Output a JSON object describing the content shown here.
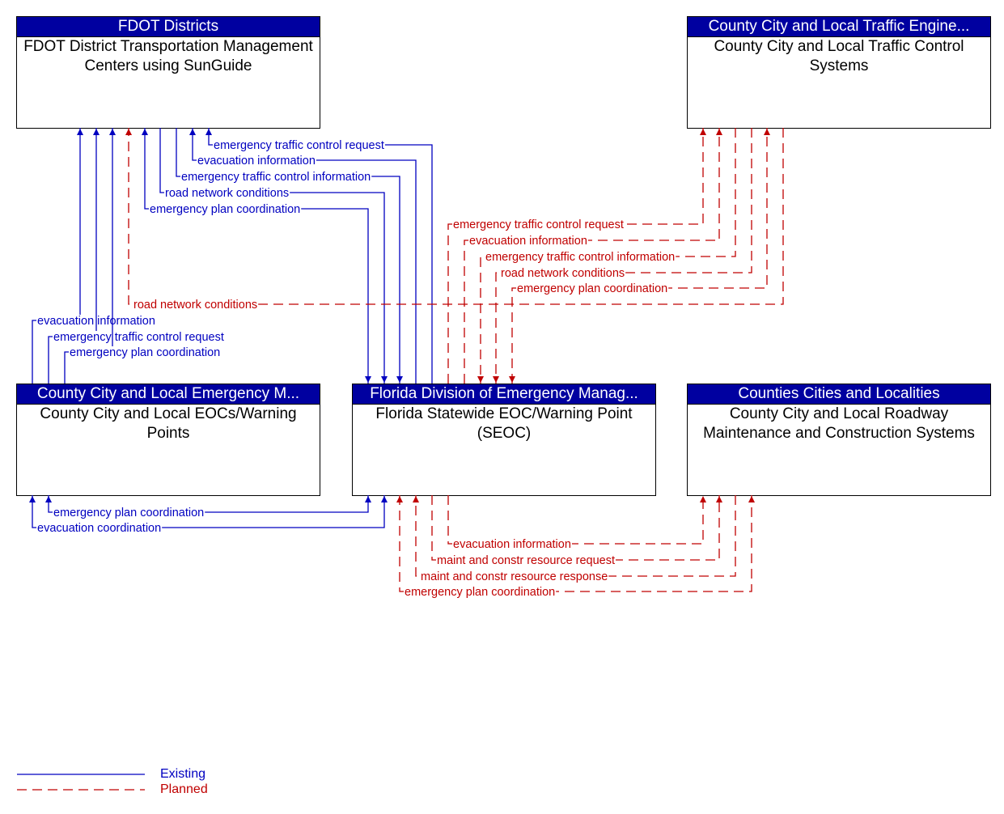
{
  "colors": {
    "existing": "#0000c0",
    "planned": "#c00000",
    "header_bg": "#0000a0"
  },
  "nodes": {
    "fdot": {
      "header": "FDOT Districts",
      "body": "FDOT District Transportation Management Centers using SunGuide"
    },
    "traffic": {
      "header": "County City and Local Traffic Engine...",
      "body": "County City and Local Traffic Control Systems"
    },
    "county_eoc": {
      "header": "County City and Local Emergency M...",
      "body": "County City and Local EOCs/Warning Points"
    },
    "seoc": {
      "header": "Florida Division of Emergency Manag...",
      "body": "Florida Statewide EOC/Warning Point (SEOC)"
    },
    "roadway": {
      "header": "Counties Cities and Localities",
      "body": "County City and Local Roadway Maintenance and Construction Systems"
    }
  },
  "flows": [
    {
      "id": "f1",
      "label": "emergency traffic control request",
      "from": "seoc",
      "to": "fdot",
      "status": "existing"
    },
    {
      "id": "f2",
      "label": "evacuation information",
      "from": "seoc",
      "to": "fdot",
      "status": "existing"
    },
    {
      "id": "f3",
      "label": "emergency traffic control information",
      "from": "fdot",
      "to": "seoc",
      "status": "existing"
    },
    {
      "id": "f4",
      "label": "road network conditions",
      "from": "fdot",
      "to": "seoc",
      "status": "existing"
    },
    {
      "id": "f5",
      "label": "emergency plan coordination",
      "from": "seoc",
      "to": "fdot",
      "status": "existing",
      "bidirectional": true
    },
    {
      "id": "f6",
      "label": "road network conditions",
      "from": "traffic",
      "to": "fdot",
      "status": "planned"
    },
    {
      "id": "f7",
      "label": "evacuation information",
      "from": "county_eoc",
      "to": "fdot",
      "status": "existing"
    },
    {
      "id": "f8",
      "label": "emergency traffic control request",
      "from": "county_eoc",
      "to": "fdot",
      "status": "existing"
    },
    {
      "id": "f9",
      "label": "emergency plan coordination",
      "from": "county_eoc",
      "to": "fdot",
      "status": "existing"
    },
    {
      "id": "f10",
      "label": "emergency traffic control request",
      "from": "seoc",
      "to": "traffic",
      "status": "planned"
    },
    {
      "id": "f11",
      "label": "evacuation information",
      "from": "seoc",
      "to": "traffic",
      "status": "planned"
    },
    {
      "id": "f12",
      "label": "emergency traffic control information",
      "from": "traffic",
      "to": "seoc",
      "status": "planned"
    },
    {
      "id": "f13",
      "label": "road network conditions",
      "from": "traffic",
      "to": "seoc",
      "status": "planned"
    },
    {
      "id": "f14",
      "label": "emergency plan coordination",
      "from": "seoc",
      "to": "traffic",
      "status": "planned",
      "bidirectional": true
    },
    {
      "id": "f15",
      "label": "emergency plan coordination",
      "from": "seoc",
      "to": "county_eoc",
      "status": "existing",
      "bidirectional": true
    },
    {
      "id": "f16",
      "label": "evacuation coordination",
      "from": "seoc",
      "to": "county_eoc",
      "status": "existing",
      "bidirectional": true
    },
    {
      "id": "f17",
      "label": "evacuation information",
      "from": "seoc",
      "to": "roadway",
      "status": "planned"
    },
    {
      "id": "f18",
      "label": "maint and constr resource request",
      "from": "seoc",
      "to": "roadway",
      "status": "planned"
    },
    {
      "id": "f19",
      "label": "maint and constr resource response",
      "from": "roadway",
      "to": "seoc",
      "status": "planned"
    },
    {
      "id": "f20",
      "label": "emergency plan coordination",
      "from": "seoc",
      "to": "roadway",
      "status": "planned",
      "bidirectional": true
    }
  ],
  "legend": {
    "existing": "Existing",
    "planned": "Planned"
  }
}
